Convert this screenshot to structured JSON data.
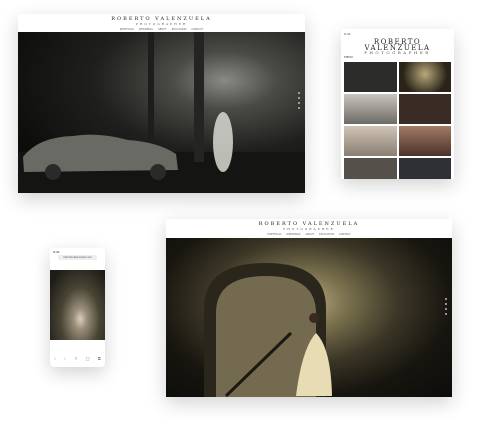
{
  "brand": {
    "name": "ROBERTO VALENZUELA",
    "subtitle": "PHOTOGRAPHER"
  },
  "desktop_top": {
    "nav": [
      "PORTFOLIO",
      "WEDDINGS",
      "ABOUT",
      "EDUCATION",
      "CONTACT"
    ]
  },
  "tablet": {
    "status": "9:41",
    "menu_label": "MENU"
  },
  "phone": {
    "status_time": "9:41",
    "url": "robertovalenzuela.com"
  },
  "desktop_bottom": {
    "nav": [
      "PORTFOLIO",
      "WEDDINGS",
      "ABOUT",
      "EDUCATION",
      "CONTACT"
    ]
  },
  "colors": {
    "page_bg": "#ffffff",
    "photo_dark": "#0c0c0b"
  }
}
